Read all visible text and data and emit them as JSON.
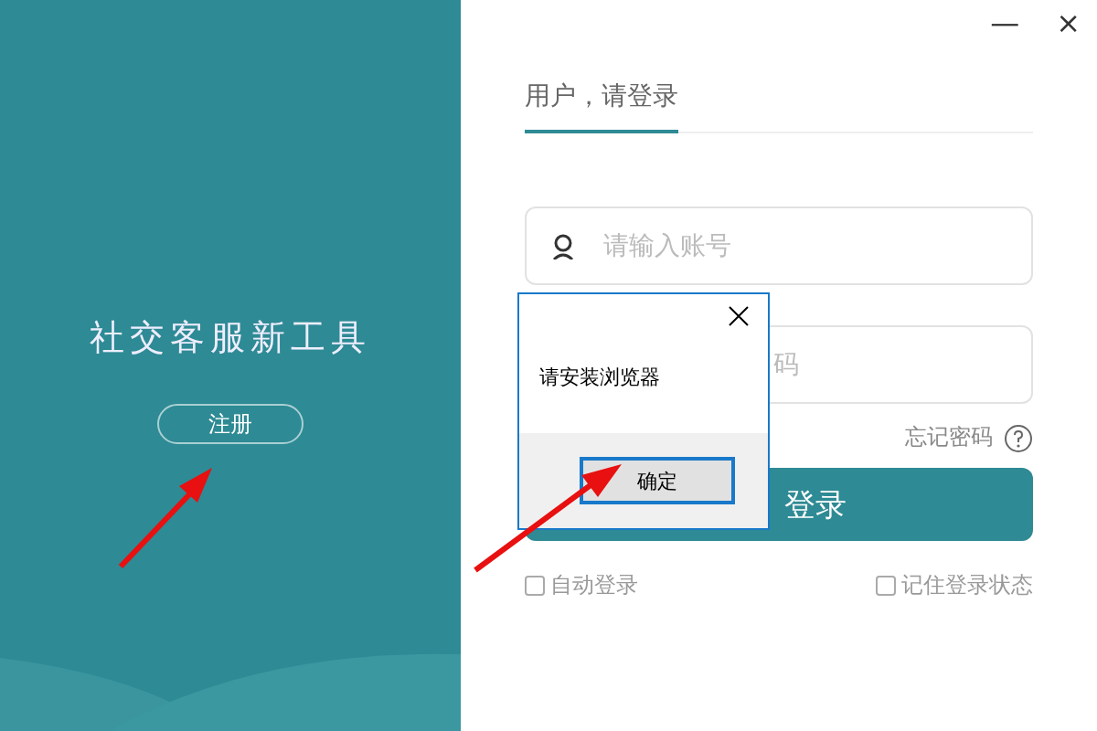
{
  "side_panel": {
    "slogan": "社交客服新工具",
    "register_button": "注册"
  },
  "window_controls": {
    "minimize": "—",
    "close": "×"
  },
  "login_tab": {
    "label": "用户，请登录",
    "selected": true
  },
  "account_field": {
    "placeholder": "请输入账号"
  },
  "password_field": {
    "placeholder": "码"
  },
  "forgot_password": "忘记密码",
  "login_button": "登录",
  "options": [
    {
      "label": "自动登录",
      "checked": false
    },
    {
      "label": "记住登录状态",
      "checked": false
    }
  ],
  "dialog": {
    "message": "请安装浏览器",
    "ok_button": "确定"
  }
}
